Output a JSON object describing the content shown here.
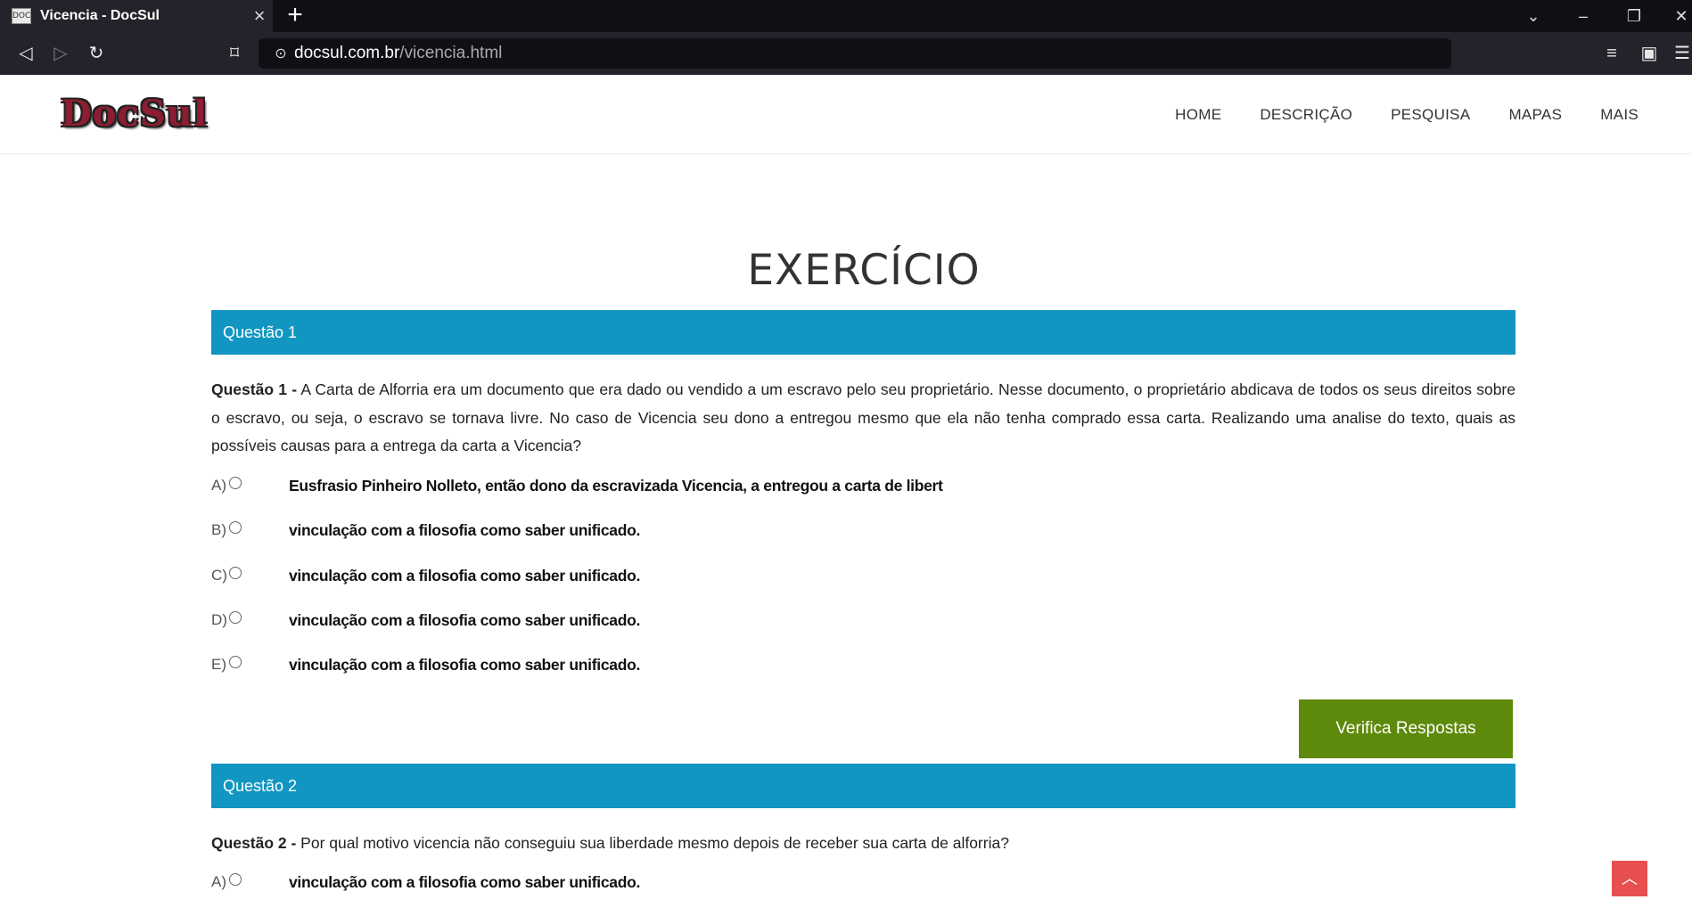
{
  "browser": {
    "tab_title": "Vicencia - DocSul",
    "favicon_text": "DOC",
    "url_host": "docsul.com.br",
    "url_path": "/vicencia.html"
  },
  "site": {
    "logo": "DocSul",
    "menu": [
      "HOME",
      "DESCRIÇÃO",
      "PESQUISA",
      "MAPAS",
      "MAIS"
    ]
  },
  "page_title": "EXERCÍCIO",
  "questions": [
    {
      "header": "Questão 1",
      "label": "Questão 1 -",
      "text": " A Carta de Alforria era um documento que era dado ou vendido a um escravo pelo seu proprietário. Nesse documento, o proprietário abdicava de todos os seus direitos sobre o escravo, ou seja, o escravo se tornava livre. No caso de Vicencia seu dono a entregou mesmo que ela não tenha comprado essa carta. Realizando uma analise do texto, quais as possíveis causas para a entrega da carta a Vicencia?",
      "options": [
        {
          "letter": "A)",
          "text": "Eusfrasio Pinheiro Nolleto, então dono da escravizada Vicencia, a entregou a carta de libert"
        },
        {
          "letter": "B)",
          "text": "vinculação com a filosofia como saber unificado."
        },
        {
          "letter": "C)",
          "text": "vinculação com a filosofia como saber unificado."
        },
        {
          "letter": "D)",
          "text": "vinculação com a filosofia como saber unificado."
        },
        {
          "letter": "E)",
          "text": "vinculação com a filosofia como saber unificado."
        }
      ]
    },
    {
      "header": "Questão 2",
      "label": "Questão 2 -",
      "text": " Por qual motivo vicencia não conseguiu sua liberdade mesmo depois de receber sua carta de alforria?",
      "options": [
        {
          "letter": "A)",
          "text": "vinculação com a filosofia como saber unificado."
        }
      ]
    }
  ],
  "verify_button": "Verifica Respostas",
  "back_to_top_icon": "chevron-up-icon",
  "colors": {
    "question_header": "#1196c2",
    "verify_button": "#5e8a0c",
    "back_to_top": "#e8504f"
  }
}
